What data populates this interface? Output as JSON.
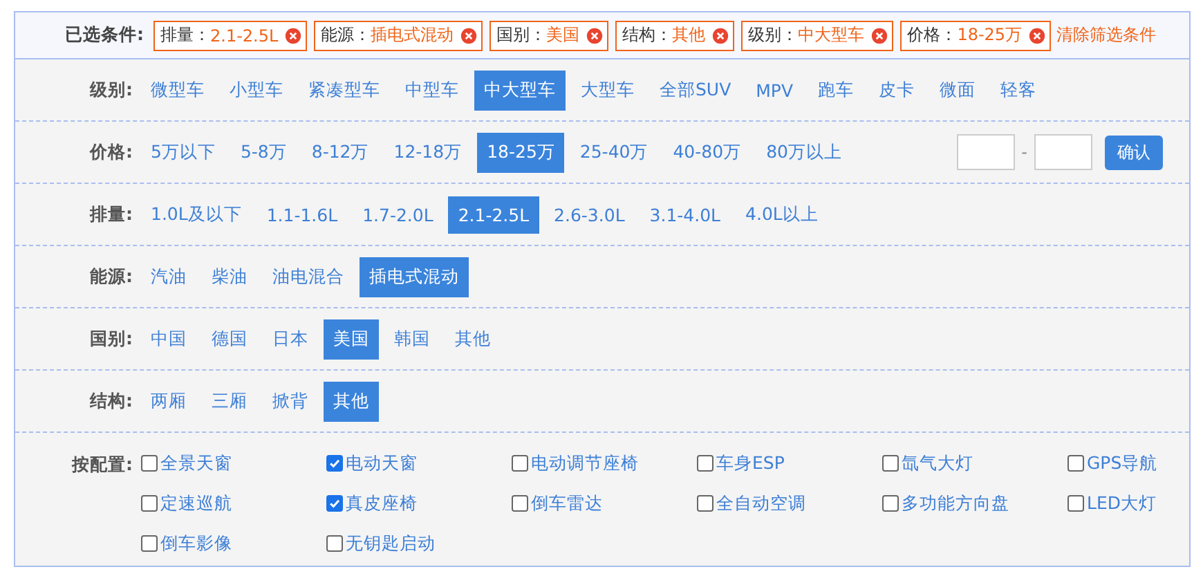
{
  "selected_conditions": {
    "label": "已选条件:",
    "chips": [
      {
        "name": "排量：",
        "value": "2.1-2.5L"
      },
      {
        "name": "能源：",
        "value": "插电式混动"
      },
      {
        "name": "国别：",
        "value": "美国"
      },
      {
        "name": "结构：",
        "value": "其他"
      },
      {
        "name": "级别：",
        "value": "中大型车"
      },
      {
        "name": "价格：",
        "value": "18-25万"
      }
    ],
    "clear_link": "清除筛选条件"
  },
  "filters": [
    {
      "label": "级别:",
      "options": [
        {
          "label": "微型车",
          "selected": false
        },
        {
          "label": "小型车",
          "selected": false
        },
        {
          "label": "紧凑型车",
          "selected": false
        },
        {
          "label": "中型车",
          "selected": false
        },
        {
          "label": "中大型车",
          "selected": true
        },
        {
          "label": "大型车",
          "selected": false
        },
        {
          "label": "全部SUV",
          "selected": false
        },
        {
          "label": "MPV",
          "selected": false
        },
        {
          "label": "跑车",
          "selected": false
        },
        {
          "label": "皮卡",
          "selected": false
        },
        {
          "label": "微面",
          "selected": false
        },
        {
          "label": "轻客",
          "selected": false
        }
      ]
    },
    {
      "label": "价格:",
      "options": [
        {
          "label": "5万以下",
          "selected": false
        },
        {
          "label": "5-8万",
          "selected": false
        },
        {
          "label": "8-12万",
          "selected": false
        },
        {
          "label": "12-18万",
          "selected": false
        },
        {
          "label": "18-25万",
          "selected": true
        },
        {
          "label": "25-40万",
          "selected": false
        },
        {
          "label": "40-80万",
          "selected": false
        },
        {
          "label": "80万以上",
          "selected": false
        }
      ],
      "range": {
        "separator": "-",
        "button": "确认"
      }
    },
    {
      "label": "排量:",
      "options": [
        {
          "label": "1.0L及以下",
          "selected": false
        },
        {
          "label": "1.1-1.6L",
          "selected": false
        },
        {
          "label": "1.7-2.0L",
          "selected": false
        },
        {
          "label": "2.1-2.5L",
          "selected": true
        },
        {
          "label": "2.6-3.0L",
          "selected": false
        },
        {
          "label": "3.1-4.0L",
          "selected": false
        },
        {
          "label": "4.0L以上",
          "selected": false
        }
      ]
    },
    {
      "label": "能源:",
      "options": [
        {
          "label": "汽油",
          "selected": false
        },
        {
          "label": "柴油",
          "selected": false
        },
        {
          "label": "油电混合",
          "selected": false
        },
        {
          "label": "插电式混动",
          "selected": true
        }
      ]
    },
    {
      "label": "国别:",
      "options": [
        {
          "label": "中国",
          "selected": false
        },
        {
          "label": "德国",
          "selected": false
        },
        {
          "label": "日本",
          "selected": false
        },
        {
          "label": "美国",
          "selected": true
        },
        {
          "label": "韩国",
          "selected": false
        },
        {
          "label": "其他",
          "selected": false
        }
      ]
    },
    {
      "label": "结构:",
      "options": [
        {
          "label": "两厢",
          "selected": false
        },
        {
          "label": "三厢",
          "selected": false
        },
        {
          "label": "掀背",
          "selected": false
        },
        {
          "label": "其他",
          "selected": true
        }
      ]
    }
  ],
  "configuration": {
    "label": "按配置:",
    "items": [
      {
        "label": "全景天窗",
        "checked": false
      },
      {
        "label": "电动天窗",
        "checked": true
      },
      {
        "label": "电动调节座椅",
        "checked": false
      },
      {
        "label": "车身ESP",
        "checked": false
      },
      {
        "label": "氙气大灯",
        "checked": false
      },
      {
        "label": "GPS导航",
        "checked": false
      },
      {
        "label": "定速巡航",
        "checked": false
      },
      {
        "label": "真皮座椅",
        "checked": true
      },
      {
        "label": "倒车雷达",
        "checked": false
      },
      {
        "label": "全自动空调",
        "checked": false
      },
      {
        "label": "多功能方向盘",
        "checked": false
      },
      {
        "label": "LED大灯",
        "checked": false
      },
      {
        "label": "倒车影像",
        "checked": false
      },
      {
        "label": "无钥匙启动",
        "checked": false
      }
    ]
  }
}
